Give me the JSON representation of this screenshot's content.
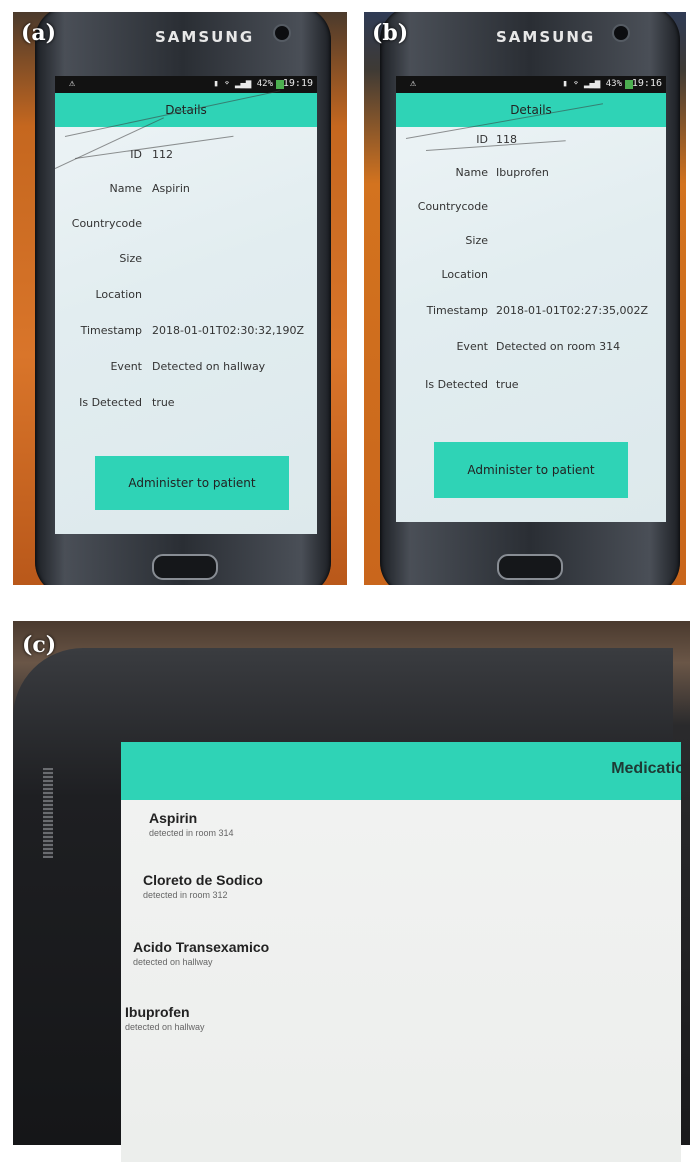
{
  "panels": {
    "a": {
      "letter": "(a)",
      "brand": "SAMSUNG",
      "status": {
        "signal": "42%",
        "time": "19:19"
      },
      "title": "Details",
      "fields": [
        {
          "label": "ID",
          "value": "112"
        },
        {
          "label": "Name",
          "value": "Aspirin"
        },
        {
          "label": "Countrycode",
          "value": ""
        },
        {
          "label": "Size",
          "value": ""
        },
        {
          "label": "Location",
          "value": ""
        },
        {
          "label": "Timestamp",
          "value": "2018-01-01T02:30:32,190Z"
        },
        {
          "label": "Event",
          "value": "Detected on hallway"
        },
        {
          "label": "Is Detected",
          "value": "true"
        }
      ],
      "button": "Administer to patient"
    },
    "b": {
      "letter": "(b)",
      "brand": "SAMSUNG",
      "status": {
        "signal": "43%",
        "time": "19:16"
      },
      "title": "Details",
      "fields": [
        {
          "label": "ID",
          "value": "118"
        },
        {
          "label": "Name",
          "value": "Ibuprofen"
        },
        {
          "label": "Countrycode",
          "value": ""
        },
        {
          "label": "Size",
          "value": ""
        },
        {
          "label": "Location",
          "value": ""
        },
        {
          "label": "Timestamp",
          "value": "2018-01-01T02:27:35,002Z"
        },
        {
          "label": "Event",
          "value": "Detected on room 314"
        },
        {
          "label": "Is Detected",
          "value": "true"
        }
      ],
      "button": "Administer to patient"
    },
    "c": {
      "letter": "(c)",
      "title": "Medicatio",
      "items": [
        {
          "name": "Aspirin",
          "sub": "detected in room 314"
        },
        {
          "name": "Cloreto de Sodico",
          "sub": "detected in room 312"
        },
        {
          "name": "Acido Transexamico",
          "sub": "detected on hallway"
        },
        {
          "name": "Ibuprofen",
          "sub": "detected on hallway"
        }
      ]
    }
  },
  "colors": {
    "accent": "#2fd3b6",
    "screen": "#e6eff1",
    "phone_body": "#2a2e34"
  }
}
